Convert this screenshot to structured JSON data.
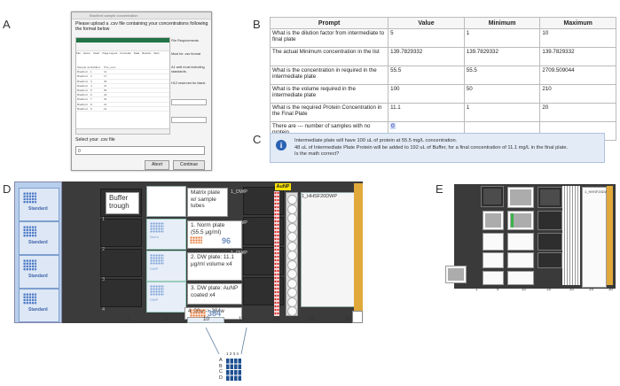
{
  "panel_labels": {
    "a": "A",
    "b": "B",
    "c": "C",
    "d": "D",
    "e": "E"
  },
  "dialog": {
    "title": "Bradford sample concentration",
    "prompt": "Please upload a .csv file containing your concentrations following the format below",
    "excel_tabs": [
      "File",
      "Home",
      "Insert",
      "Page Layout",
      "Formulas",
      "Data",
      "Review",
      "View"
    ],
    "excel_rows": [
      [
        "Sample name",
        "Distilled",
        "Prot_conc"
      ],
      [
        "Bradford",
        "1",
        "12"
      ],
      [
        "Bradford",
        "2",
        "17"
      ],
      [
        "Bradford",
        "3",
        "35"
      ],
      [
        "Bradford",
        "4",
        "47"
      ],
      [
        "Bradford",
        "5",
        "55"
      ],
      [
        "Bradford",
        "6",
        "44"
      ],
      [
        "Bradford",
        "7",
        "33"
      ],
      [
        "Bradford",
        "8",
        "21"
      ],
      [
        "Bradford",
        "9",
        "14"
      ]
    ],
    "notes": [
      "File Requirements",
      "Must be .csv format",
      "A1 well must including standards.",
      "H12 reserved for blank"
    ],
    "select_label": "Select your .csv file",
    "file_value": "0",
    "abort_label": "Abort",
    "continue_label": "Continue"
  },
  "table": {
    "headers": [
      "Prompt",
      "Value",
      "Minimum",
      "Maximum"
    ],
    "rows": [
      {
        "prompt": "What is the dilution factor from intermediate to final plate",
        "value": "5",
        "min": "1",
        "max": "10"
      },
      {
        "prompt": "The actual Minimum concentration in the list",
        "value": "139.7829332",
        "min": "139.7829332",
        "max": "139.7829332"
      },
      {
        "prompt": "What is the concentration in required in the intermediate plate",
        "value": "55.5",
        "min": "55.5",
        "max": "2709.509044"
      },
      {
        "prompt": "What is the volume required in the intermediate plate",
        "value": "100",
        "min": "50",
        "max": "210"
      },
      {
        "prompt": "What is the required Protein Concentration in the Final Plate",
        "value": "11.1",
        "min": "1",
        "max": "20"
      },
      {
        "prompt": "There are --- number of samples with no protein",
        "value": "0",
        "min": "",
        "max": ""
      }
    ]
  },
  "alert": {
    "line1": "Intermediate plate will have 100 uL of protein at 55.5 mg/L concentration.",
    "line2": "48 uL of Intermediate Plate Protein will be added to 192 uL of Buffer, for a final concentration of 11.1 mg/L in the final plate.",
    "line3": "Is the math correct?"
  },
  "deck_d": {
    "tip_label": "Standard",
    "buffer_label": "Buffer trough",
    "matrix_label": "Matrix plate w/ sample tubes",
    "step1": "1. Norm plate (55.5 μg/ml)",
    "step2": "2. DW plate: 11.1 μg/ml volume x4",
    "step3": "3. DW plate: AuNP coated x4",
    "step4": "4. 96w -> 384w",
    "badge96": "96",
    "badge384": "384",
    "dwp_labels": [
      "1_DWP",
      "1_DWP",
      "1_DWP"
    ],
    "aunp": "AuNP",
    "hhsf": "1_HHSF20DWP",
    "slot_left": [
      "1",
      "2",
      "3",
      "4"
    ],
    "axis": [
      "1",
      "5",
      "10",
      "15",
      "20",
      "25",
      "30"
    ],
    "inset_rows": [
      "A",
      "B",
      "C",
      "D"
    ],
    "inset_cols": [
      "1",
      "2",
      "3",
      "4"
    ]
  },
  "deck_e": {
    "label": "1_HHSF20DWP",
    "axis": [
      "1",
      "5",
      "10",
      "15",
      "20",
      "25",
      "30"
    ]
  }
}
